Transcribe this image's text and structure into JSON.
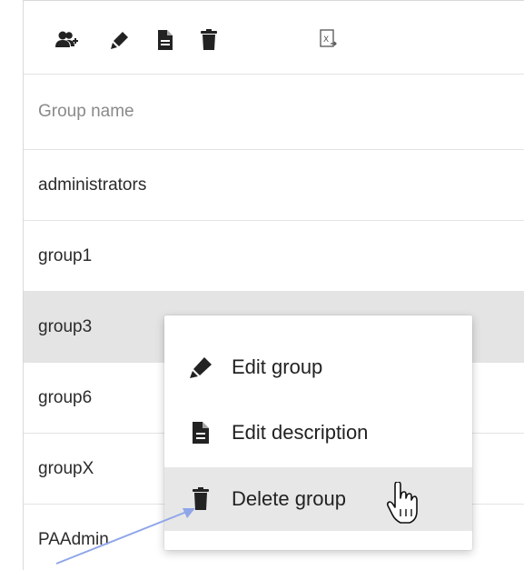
{
  "toolbar": {
    "buttons": [
      {
        "icon": "add-user-icon"
      },
      {
        "icon": "pencil-icon"
      },
      {
        "icon": "document-icon"
      },
      {
        "icon": "trash-icon"
      },
      {
        "icon": "excel-export-icon"
      }
    ]
  },
  "table": {
    "column_header": "Group name",
    "rows": [
      "administrators",
      "group1",
      "group3",
      "group6",
      "groupX",
      "PAAdmin"
    ],
    "selected_row": "group3"
  },
  "context_menu": {
    "items": [
      {
        "label": "Edit group",
        "icon": "pencil-icon"
      },
      {
        "label": "Edit description",
        "icon": "document-icon"
      },
      {
        "label": "Delete group",
        "icon": "trash-icon"
      }
    ],
    "hovered_item": "Delete group"
  },
  "colors": {
    "icon": "#222222",
    "selected_row": "#e4e4e4",
    "menu_hover": "#e7e7e7",
    "annotation_arrow": "#8fa6e8"
  }
}
